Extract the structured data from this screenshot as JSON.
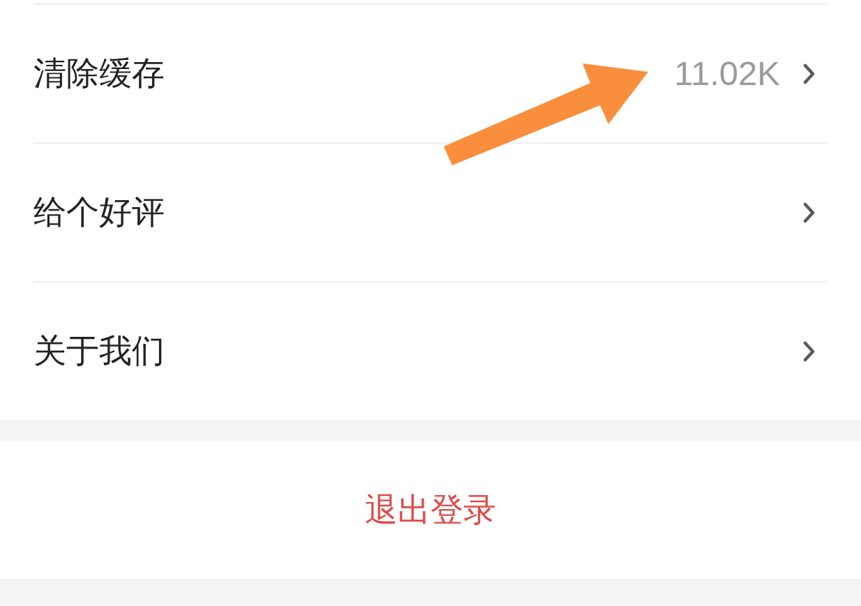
{
  "settings_list": [
    {
      "label": "清除缓存",
      "value": "11.02K"
    },
    {
      "label": "给个好评"
    },
    {
      "label": "关于我们"
    }
  ],
  "logout_button": {
    "label": "退出登录"
  }
}
